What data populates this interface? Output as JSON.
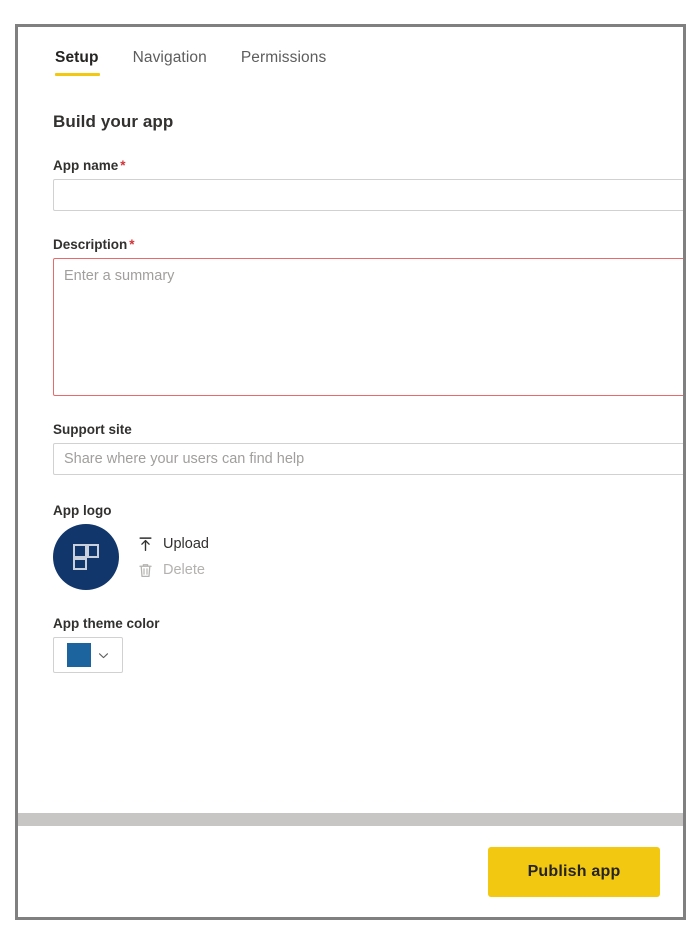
{
  "tabs": [
    {
      "label": "Setup",
      "active": true
    },
    {
      "label": "Navigation",
      "active": false
    },
    {
      "label": "Permissions",
      "active": false
    }
  ],
  "section": {
    "title": "Build your app"
  },
  "fields": {
    "app_name": {
      "label": "App name",
      "required_marker": "*",
      "value": "",
      "placeholder": ""
    },
    "description": {
      "label": "Description",
      "required_marker": "*",
      "value": "",
      "placeholder": "Enter a summary"
    },
    "support_site": {
      "label": "Support site",
      "value": "",
      "placeholder": "Share where your users can find help"
    }
  },
  "app_logo": {
    "label": "App logo",
    "upload_label": "Upload",
    "delete_label": "Delete",
    "logo_background": "#11366b",
    "logo_icon": "grid-blocks-icon"
  },
  "theme_color": {
    "label": "App theme color",
    "selected_color": "#1b649e"
  },
  "footer": {
    "publish_label": "Publish app",
    "publish_color": "#f2c811"
  }
}
